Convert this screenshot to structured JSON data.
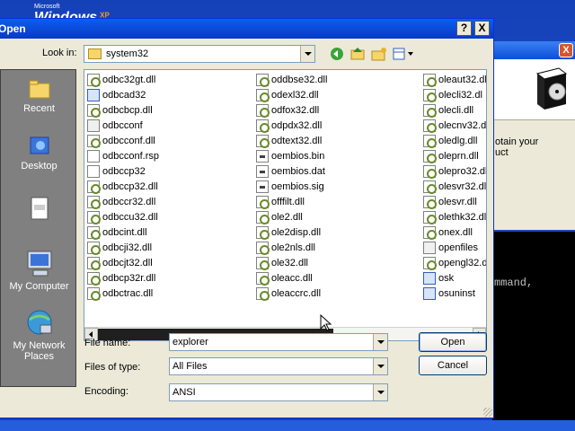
{
  "desktop": {
    "brand_small": "Microsoft",
    "brand_name": "Windows",
    "brand_suffix": "XP"
  },
  "background_window": {
    "partial_text": "otain your\nuct",
    "close_label": "X"
  },
  "console": {
    "partial_text": "mmand,"
  },
  "dialog": {
    "title": "Open",
    "help_label": "?",
    "close_label": "X",
    "look_in_label": "Look in:",
    "look_in_value": "system32",
    "places": [
      {
        "label": "Recent",
        "icon": "recent-folder-icon"
      },
      {
        "label": "Desktop",
        "icon": "desktop-icon"
      },
      {
        "label": "",
        "icon": "my-documents-icon"
      },
      {
        "label": "My Computer",
        "icon": "my-computer-icon"
      },
      {
        "label": "My Network Places",
        "icon": "network-places-icon"
      }
    ],
    "files": {
      "col1": [
        {
          "name": "odbc32gt.dll",
          "type": "dll"
        },
        {
          "name": "odbcad32",
          "type": "exe"
        },
        {
          "name": "odbcbcp.dll",
          "type": "dll"
        },
        {
          "name": "odbcconf",
          "type": "cfg"
        },
        {
          "name": "odbcconf.dll",
          "type": "dll"
        },
        {
          "name": "odbcconf.rsp",
          "type": "txt"
        },
        {
          "name": "odbccp32",
          "type": "txt"
        },
        {
          "name": "odbccp32.dll",
          "type": "dll"
        },
        {
          "name": "odbccr32.dll",
          "type": "dll"
        },
        {
          "name": "odbccu32.dll",
          "type": "dll"
        },
        {
          "name": "odbcint.dll",
          "type": "dll"
        },
        {
          "name": "odbcji32.dll",
          "type": "dll"
        },
        {
          "name": "odbcjt32.dll",
          "type": "dll"
        },
        {
          "name": "odbcp32r.dll",
          "type": "dll"
        },
        {
          "name": "odbctrac.dll",
          "type": "dll"
        }
      ],
      "col2": [
        {
          "name": "oddbse32.dll",
          "type": "dll"
        },
        {
          "name": "odexl32.dll",
          "type": "dll"
        },
        {
          "name": "odfox32.dll",
          "type": "dll"
        },
        {
          "name": "odpdx32.dll",
          "type": "dll"
        },
        {
          "name": "odtext32.dll",
          "type": "dll"
        },
        {
          "name": "oembios.bin",
          "type": "bin"
        },
        {
          "name": "oembios.dat",
          "type": "bin"
        },
        {
          "name": "oembios.sig",
          "type": "bin"
        },
        {
          "name": "offfilt.dll",
          "type": "dll"
        },
        {
          "name": "ole2.dll",
          "type": "dll"
        },
        {
          "name": "ole2disp.dll",
          "type": "dll"
        },
        {
          "name": "ole2nls.dll",
          "type": "dll"
        },
        {
          "name": "ole32.dll",
          "type": "dll"
        },
        {
          "name": "oleacc.dll",
          "type": "dll"
        },
        {
          "name": "oleaccrc.dll",
          "type": "dll"
        }
      ],
      "col3": [
        {
          "name": "oleaut32.dl",
          "type": "dll"
        },
        {
          "name": "olecli32.dl",
          "type": "dll"
        },
        {
          "name": "olecli.dll",
          "type": "dll"
        },
        {
          "name": "olecnv32.dl",
          "type": "dll"
        },
        {
          "name": "oledlg.dll",
          "type": "dll"
        },
        {
          "name": "oleprn.dll",
          "type": "dll"
        },
        {
          "name": "olepro32.dl",
          "type": "dll"
        },
        {
          "name": "olesvr32.dl",
          "type": "dll"
        },
        {
          "name": "olesvr.dll",
          "type": "dll"
        },
        {
          "name": "olethk32.dl",
          "type": "dll"
        },
        {
          "name": "onex.dll",
          "type": "dll"
        },
        {
          "name": "openfiles",
          "type": "cfg"
        },
        {
          "name": "opengl32.d",
          "type": "dll"
        },
        {
          "name": "osk",
          "type": "exe"
        },
        {
          "name": "osuninst",
          "type": "exe"
        }
      ]
    },
    "file_name_label": "File name:",
    "file_name_value": "explorer",
    "files_of_type_label": "Files of type:",
    "files_of_type_value": "All Files",
    "encoding_label": "Encoding:",
    "encoding_value": "ANSI",
    "open_button": "Open",
    "cancel_button": "Cancel"
  }
}
